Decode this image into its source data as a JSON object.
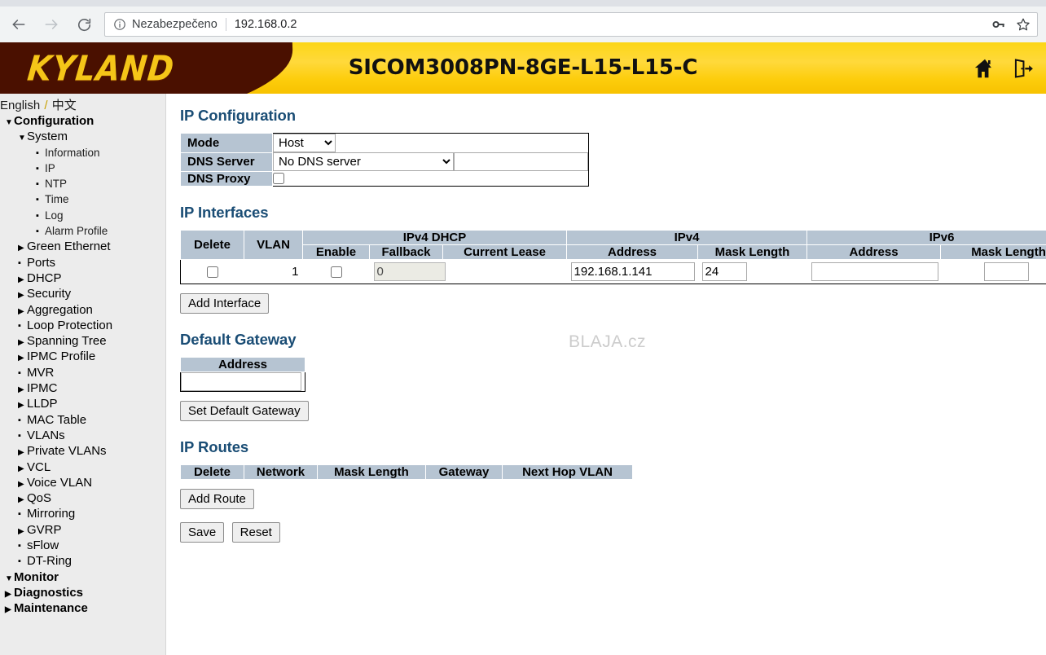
{
  "browser": {
    "back_icon": "back-arrow-icon",
    "forward_icon": "forward-arrow-icon",
    "reload_icon": "reload-icon",
    "info_icon": "info-circle-icon",
    "security_label": "Nezabezpečeno",
    "url": "192.168.0.2",
    "key_icon": "key-icon",
    "star_icon": "star-bookmark-icon"
  },
  "header": {
    "logo_text": "KYLAND",
    "device_model": "SICOM3008PN-8GE-L15-L15-C",
    "home_icon": "home-icon",
    "logout_icon": "logout-door-icon",
    "colors": {
      "banner": "#fdd116",
      "logo_bg": "#4a1000",
      "logo_fg": "#f5c518"
    }
  },
  "sidebar": {
    "language": {
      "english": "English",
      "separator": "/",
      "chinese": "中文"
    },
    "tree": [
      {
        "label": "Configuration",
        "level": 0,
        "marker": "expanded"
      },
      {
        "label": "System",
        "level": 1,
        "marker": "expanded"
      },
      {
        "label": "Information",
        "level": 2,
        "marker": "bullet"
      },
      {
        "label": "IP",
        "level": 2,
        "marker": "bullet"
      },
      {
        "label": "NTP",
        "level": 2,
        "marker": "bullet"
      },
      {
        "label": "Time",
        "level": 2,
        "marker": "bullet"
      },
      {
        "label": "Log",
        "level": 2,
        "marker": "bullet"
      },
      {
        "label": "Alarm Profile",
        "level": 2,
        "marker": "bullet"
      },
      {
        "label": "Green Ethernet",
        "level": 1,
        "marker": "collapsed"
      },
      {
        "label": "Ports",
        "level": 1,
        "marker": "bullet"
      },
      {
        "label": "DHCP",
        "level": 1,
        "marker": "collapsed"
      },
      {
        "label": "Security",
        "level": 1,
        "marker": "collapsed"
      },
      {
        "label": "Aggregation",
        "level": 1,
        "marker": "collapsed"
      },
      {
        "label": "Loop Protection",
        "level": 1,
        "marker": "bullet"
      },
      {
        "label": "Spanning Tree",
        "level": 1,
        "marker": "collapsed"
      },
      {
        "label": "IPMC Profile",
        "level": 1,
        "marker": "collapsed"
      },
      {
        "label": "MVR",
        "level": 1,
        "marker": "bullet"
      },
      {
        "label": "IPMC",
        "level": 1,
        "marker": "collapsed"
      },
      {
        "label": "LLDP",
        "level": 1,
        "marker": "collapsed"
      },
      {
        "label": "MAC Table",
        "level": 1,
        "marker": "bullet"
      },
      {
        "label": "VLANs",
        "level": 1,
        "marker": "bullet"
      },
      {
        "label": "Private VLANs",
        "level": 1,
        "marker": "collapsed"
      },
      {
        "label": "VCL",
        "level": 1,
        "marker": "collapsed"
      },
      {
        "label": "Voice VLAN",
        "level": 1,
        "marker": "collapsed"
      },
      {
        "label": "QoS",
        "level": 1,
        "marker": "collapsed"
      },
      {
        "label": "Mirroring",
        "level": 1,
        "marker": "bullet"
      },
      {
        "label": "GVRP",
        "level": 1,
        "marker": "collapsed"
      },
      {
        "label": "sFlow",
        "level": 1,
        "marker": "bullet"
      },
      {
        "label": "DT-Ring",
        "level": 1,
        "marker": "bullet"
      },
      {
        "label": "Monitor",
        "level": 0,
        "marker": "expanded"
      },
      {
        "label": "Diagnostics",
        "level": 0,
        "marker": "collapsed"
      },
      {
        "label": "Maintenance",
        "level": 0,
        "marker": "collapsed"
      }
    ]
  },
  "main": {
    "watermark": "BLAJA.cz",
    "ip_configuration": {
      "title": "IP Configuration",
      "rows": {
        "mode_label": "Mode",
        "mode_value": "Host",
        "dns_server_label": "DNS Server",
        "dns_server_value": "No DNS server",
        "dns_server_text": "",
        "dns_proxy_label": "DNS Proxy",
        "dns_proxy_checked": false
      }
    },
    "ip_interfaces": {
      "title": "IP Interfaces",
      "group_headers": {
        "ipv4_dhcp": "IPv4 DHCP",
        "ipv4": "IPv4",
        "ipv6": "IPv6"
      },
      "columns": {
        "delete": "Delete",
        "vlan": "VLAN",
        "dhcp_enable": "Enable",
        "dhcp_fallback": "Fallback",
        "dhcp_current_lease": "Current Lease",
        "ipv4_address": "Address",
        "ipv4_mask_length": "Mask Length",
        "ipv6_address": "Address",
        "ipv6_mask_length": "Mask Length"
      },
      "rows": [
        {
          "delete_checked": false,
          "vlan": "1",
          "dhcp_enable_checked": false,
          "dhcp_fallback": "0",
          "current_lease": "",
          "ipv4_address": "192.168.1.141",
          "ipv4_mask_length": "24",
          "ipv6_address": "",
          "ipv6_mask_length": ""
        }
      ],
      "add_button": "Add Interface"
    },
    "default_gateway": {
      "title": "Default Gateway",
      "column_address": "Address",
      "address_value": "",
      "set_button": "Set Default Gateway"
    },
    "ip_routes": {
      "title": "IP Routes",
      "columns": {
        "delete": "Delete",
        "network": "Network",
        "mask_length": "Mask Length",
        "gateway": "Gateway",
        "next_hop_vlan": "Next Hop VLAN"
      },
      "add_button": "Add Route"
    },
    "actions": {
      "save": "Save",
      "reset": "Reset"
    }
  }
}
